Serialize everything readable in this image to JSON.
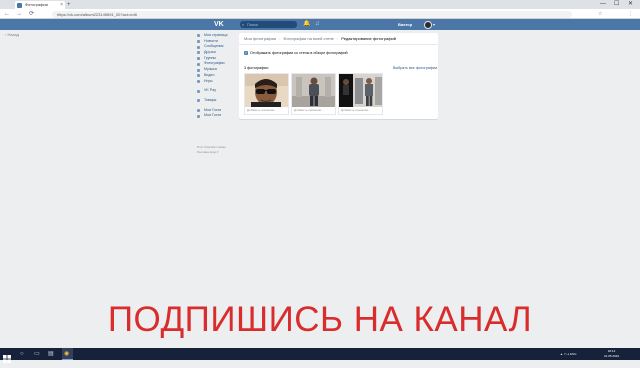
{
  "browser": {
    "tab_title": "Фотографии",
    "new_tab": "+",
    "url": "https://vk.com/album223149691_00?act=edit",
    "nav": {
      "back": "←",
      "forward": "→",
      "reload": "⟳"
    },
    "window_controls": {
      "minimize": "—",
      "maximize": "☐",
      "close": "✕"
    },
    "icons": {
      "star": "☆",
      "menu": "⋮"
    }
  },
  "vk": {
    "logo": "VK",
    "search_placeholder": "Поиск",
    "search_icon": "⌕",
    "header_icons": {
      "notifications": "🔔",
      "music": "♫"
    },
    "username": "Виктор",
    "caret": "▾"
  },
  "back_link": "‹  Назад",
  "sidebar": {
    "items": [
      {
        "label": "Моя страница",
        "icon": "home-icon"
      },
      {
        "label": "Новости",
        "icon": "news-icon"
      },
      {
        "label": "Сообщения",
        "icon": "messages-icon"
      },
      {
        "label": "Друзья",
        "icon": "friends-icon"
      },
      {
        "label": "Группы",
        "icon": "groups-icon"
      },
      {
        "label": "Фотографии",
        "icon": "photos-icon"
      },
      {
        "label": "Музыка",
        "icon": "music-icon"
      },
      {
        "label": "Видео",
        "icon": "video-icon"
      },
      {
        "label": "Игры",
        "icon": "games-icon"
      }
    ],
    "items2": [
      {
        "label": "VK Pay",
        "icon": "vkpay-icon"
      }
    ],
    "items3": [
      {
        "label": "Товары",
        "icon": "goods-icon"
      }
    ],
    "items4": [
      {
        "label": "Мои Гости",
        "icon": "guests-icon"
      },
      {
        "label": "Мои Гости",
        "icon": "guests-icon"
      }
    ],
    "footer": {
      "line1": "Блог   Разработчикам",
      "line2": "Реклама   Ещё ▾"
    }
  },
  "content": {
    "breadcrumb": {
      "item1": "Мои фотографии",
      "item2": "Фотографии на моей стене",
      "item3": "Редактирование фотографий",
      "separator": "›"
    },
    "checkbox_label": "Отображать фотографии со стены в обзоре фотографий",
    "checkbox_mark": "✓",
    "count_label": "3 фотографии",
    "select_all": "Выбрать все фотографии",
    "photos": [
      {
        "caption": "Добавить описание..."
      },
      {
        "caption": "Добавить описание..."
      },
      {
        "caption": "Добавить описание..."
      }
    ]
  },
  "banner": "ПОДПИШИСЬ НА КАНАЛ",
  "taskbar": {
    "search_icon": "○",
    "taskview_icon": "▭",
    "explorer_icon": "▤",
    "chrome_icon": "◉",
    "tray": "▲  ▭  ⅃  ENG",
    "time": "18:12",
    "date": "21.05.2019"
  },
  "colors": {
    "vk_blue": "#4a76a8",
    "link": "#2a5885",
    "background": "#edeef0",
    "banner_red": "#d92c2c",
    "taskbar": "#16223a"
  }
}
